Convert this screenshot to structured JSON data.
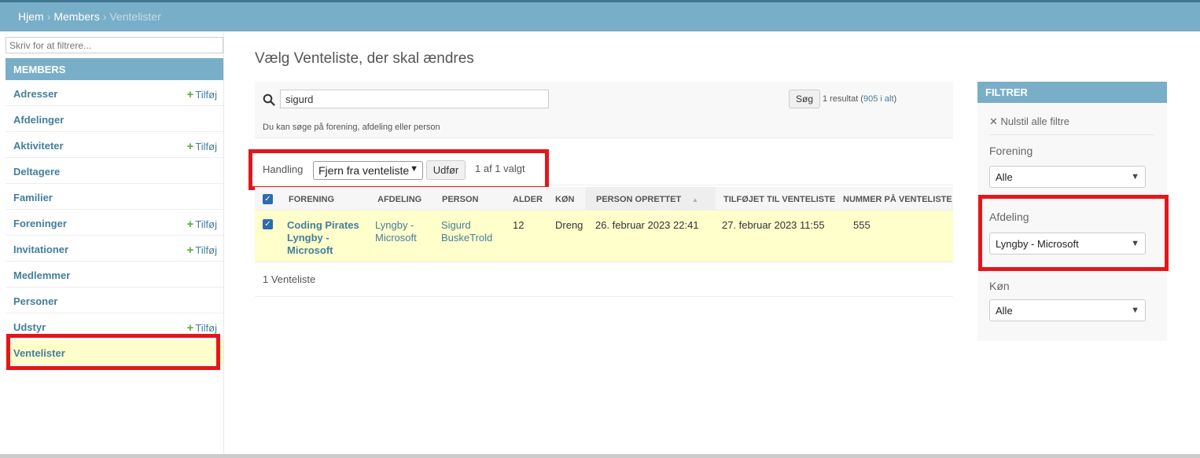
{
  "breadcrumb": {
    "home": "Hjem",
    "section": "Members",
    "current": "Ventelister",
    "sep": "›"
  },
  "sidebar": {
    "filter_placeholder": "Skriv for at filtrere...",
    "module_caption": "MEMBERS",
    "add_label": "Tilføj",
    "items": [
      {
        "label": "Adresser",
        "has_add": true
      },
      {
        "label": "Afdelinger",
        "has_add": false
      },
      {
        "label": "Aktiviteter",
        "has_add": true
      },
      {
        "label": "Deltagere",
        "has_add": false
      },
      {
        "label": "Familier",
        "has_add": false
      },
      {
        "label": "Foreninger",
        "has_add": true
      },
      {
        "label": "Invitationer",
        "has_add": true
      },
      {
        "label": "Medlemmer",
        "has_add": false
      },
      {
        "label": "Personer",
        "has_add": false
      },
      {
        "label": "Udstyr",
        "has_add": true
      },
      {
        "label": "Ventelister",
        "has_add": false,
        "current": true
      }
    ]
  },
  "page": {
    "title": "Vælg Venteliste, der skal ændres"
  },
  "search": {
    "value": "sigurd",
    "button": "Søg",
    "result_prefix": "1 resultat (",
    "result_total_link": "905 i alt",
    "result_suffix": ")",
    "help": "Du kan søge på forening, afdeling eller person"
  },
  "actions": {
    "label": "Handling",
    "selected_action": "Fjern fra venteliste",
    "go_button": "Udfør",
    "selected_count": "1 af 1 valgt"
  },
  "table": {
    "headers": {
      "forening": "FORENING",
      "afdeling": "AFDELING",
      "person": "PERSON",
      "alder": "ALDER",
      "koen": "KØN",
      "person_oprettet": "PERSON OPRETTET",
      "tilfoejet": "TILFØJET TIL VENTELISTE",
      "nummer": "NUMMER PÅ VENTELISTE"
    },
    "rows": [
      {
        "forening": "Coding Pirates Lyngby - Microsoft",
        "afdeling": "Lyngby - Microsoft",
        "person": "Sigurd BuskeTrold",
        "alder": "12",
        "koen": "Dreng",
        "person_oprettet": "26. februar 2023 22:41",
        "tilfoejet": "27. februar 2023 11:55",
        "nummer": "555",
        "checked": true
      }
    ]
  },
  "paginator": {
    "text": "1 Venteliste"
  },
  "filter": {
    "caption": "FILTRER",
    "clear": "Nulstil alle filtre",
    "clear_glyph": "✕",
    "groups": [
      {
        "title": "Forening",
        "value": "Alle"
      },
      {
        "title": "Afdeling",
        "value": "Lyngby - Microsoft"
      },
      {
        "title": "Køn",
        "value": "Alle"
      }
    ]
  },
  "colors": {
    "header": "#79aec8",
    "highlight": "#e4161b",
    "selected_row": "#ffffcc",
    "link": "#447e9b",
    "add_plus": "#5cae3b"
  },
  "icons": {
    "search": "search-icon",
    "chevron": "chevron-down-icon",
    "plus": "plus-icon",
    "close": "close-icon"
  }
}
